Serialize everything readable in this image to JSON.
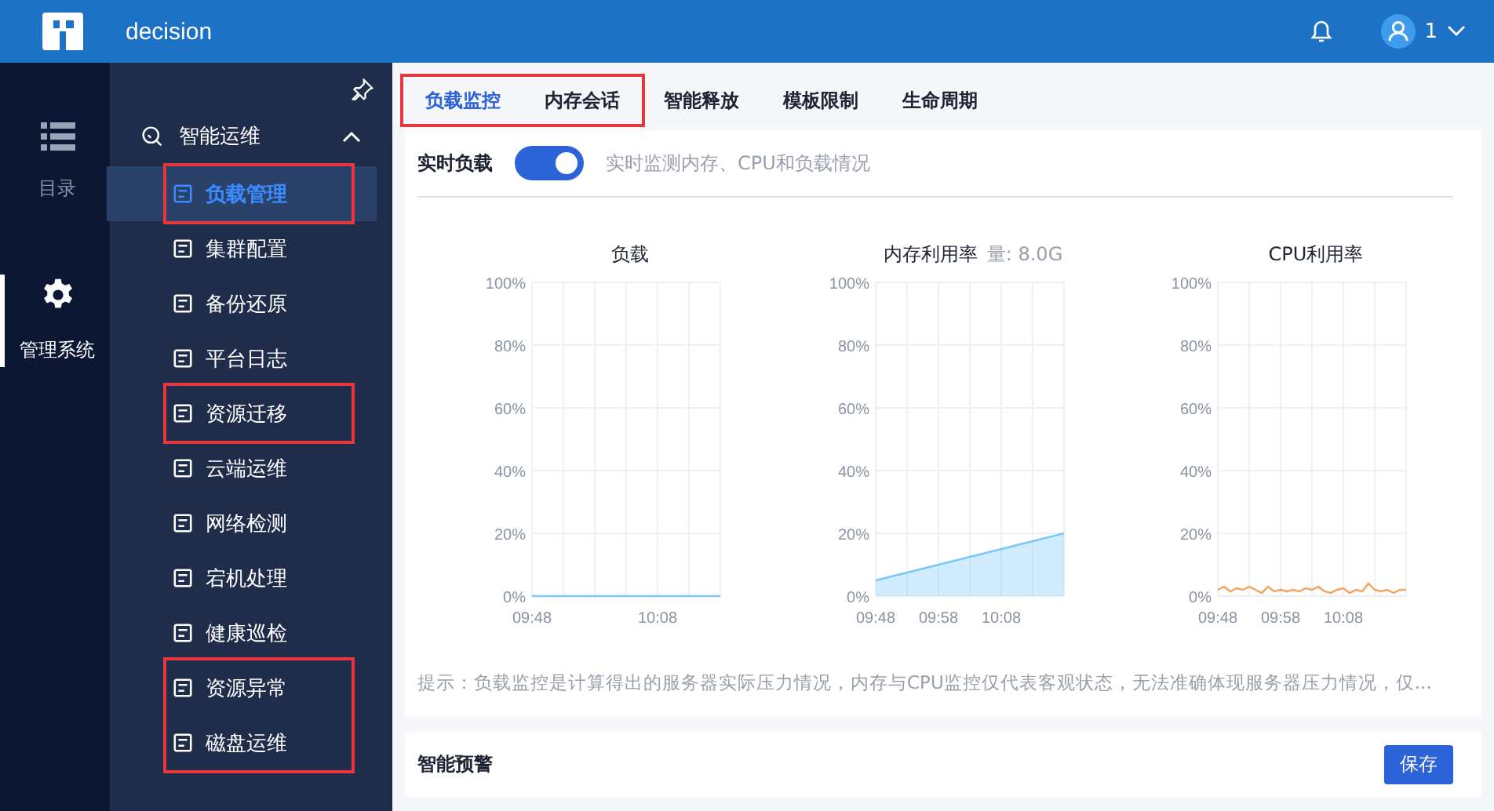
{
  "header": {
    "title": "decision",
    "user": "1"
  },
  "rail": [
    {
      "label": "目录",
      "selected": false
    },
    {
      "label": "管理系统",
      "selected": true
    }
  ],
  "sidebar": {
    "group": {
      "label": "智能运维",
      "expanded": true
    },
    "sections": [
      {
        "annotated": true,
        "items": [
          {
            "label": "负载管理",
            "selected": true
          }
        ]
      },
      {
        "annotated": false,
        "items": [
          {
            "label": "集群配置",
            "selected": false
          },
          {
            "label": "备份还原",
            "selected": false
          },
          {
            "label": "平台日志",
            "selected": false
          }
        ]
      },
      {
        "annotated": true,
        "items": [
          {
            "label": "资源迁移",
            "selected": false
          }
        ]
      },
      {
        "annotated": false,
        "items": [
          {
            "label": "云端运维",
            "selected": false
          },
          {
            "label": "网络检测",
            "selected": false
          },
          {
            "label": "宕机处理",
            "selected": false
          },
          {
            "label": "健康巡检",
            "selected": false
          }
        ]
      },
      {
        "annotated": true,
        "items": [
          {
            "label": "资源异常",
            "selected": false
          },
          {
            "label": "磁盘运维",
            "selected": false
          }
        ]
      }
    ]
  },
  "tab_groups": [
    {
      "annotated": true,
      "tabs": [
        {
          "label": "负载监控",
          "selected": true
        },
        {
          "label": "内存会话",
          "selected": false
        }
      ]
    },
    {
      "annotated": false,
      "tabs": [
        {
          "label": "智能释放",
          "selected": false
        },
        {
          "label": "模板限制",
          "selected": false
        },
        {
          "label": "生命周期",
          "selected": false
        }
      ]
    }
  ],
  "realtime": {
    "label": "实时负载",
    "on": true,
    "hint": "实时监测内存、CPU和负载情况"
  },
  "charts": [
    {
      "chart_data": {
        "type": "line",
        "title": "负载",
        "grid": true,
        "categories": [
          "09:48",
          null,
          null,
          null,
          null,
          null,
          null,
          null,
          null,
          null,
          null,
          null,
          null,
          null,
          null,
          null,
          null,
          null,
          null,
          null,
          "10:08",
          null,
          null,
          null,
          null,
          null,
          null,
          null,
          null,
          null,
          null
        ],
        "ylim": [
          0,
          100
        ],
        "yticks": [
          {
            "value": 0,
            "label": "0%"
          },
          {
            "value": 20,
            "label": "20%"
          },
          {
            "value": 40,
            "label": "40%"
          },
          {
            "value": 60,
            "label": "60%"
          },
          {
            "value": 80,
            "label": "80%"
          },
          {
            "value": 100,
            "label": "100%"
          }
        ],
        "series": [
          {
            "color": "#7cc8f5",
            "values": [
              0,
              0,
              0,
              0,
              0,
              0,
              0,
              0,
              0,
              0,
              0,
              0,
              0,
              0,
              0,
              0,
              0,
              0,
              0,
              0,
              0,
              0,
              0,
              0,
              0,
              0,
              0,
              0,
              0,
              0,
              0
            ]
          }
        ]
      }
    },
    {
      "note": "量: 8.0G",
      "chart_data": {
        "type": "area",
        "title": "内存利用率",
        "grid": true,
        "categories": [
          "09:48",
          null,
          null,
          null,
          null,
          null,
          null,
          null,
          null,
          null,
          "09:58",
          null,
          null,
          null,
          null,
          null,
          null,
          null,
          null,
          null,
          "10:08",
          null,
          null,
          null,
          null,
          null,
          null,
          null,
          null,
          null,
          null
        ],
        "ylim": [
          0,
          100
        ],
        "yticks": [
          {
            "value": 0,
            "label": "0%"
          },
          {
            "value": 20,
            "label": "20%"
          },
          {
            "value": 40,
            "label": "40%"
          },
          {
            "value": 60,
            "label": "60%"
          },
          {
            "value": 80,
            "label": "80%"
          },
          {
            "value": 100,
            "label": "100%"
          }
        ],
        "series": [
          {
            "color": "#7cc8f5",
            "values": [
              5,
              5.5,
              6,
              6.5,
              7,
              7.5,
              8,
              8.5,
              9,
              9.5,
              10,
              10.5,
              11,
              11.5,
              12,
              12.5,
              13,
              13.5,
              14,
              14.5,
              15,
              15.5,
              16,
              16.5,
              17,
              17.5,
              18,
              18.5,
              19,
              19.5,
              20
            ]
          }
        ]
      }
    },
    {
      "chart_data": {
        "type": "line",
        "title": "CPU利用率",
        "grid": true,
        "categories": [
          "09:48",
          null,
          null,
          null,
          null,
          null,
          null,
          null,
          null,
          null,
          "09:58",
          null,
          null,
          null,
          null,
          null,
          null,
          null,
          null,
          null,
          "10:08",
          null,
          null,
          null,
          null,
          null,
          null,
          null,
          null,
          null,
          null
        ],
        "ylim": [
          0,
          100
        ],
        "yticks": [
          {
            "value": 0,
            "label": "0%"
          },
          {
            "value": 20,
            "label": "20%"
          },
          {
            "value": 40,
            "label": "40%"
          },
          {
            "value": 60,
            "label": "60%"
          },
          {
            "value": 80,
            "label": "80%"
          },
          {
            "value": 100,
            "label": "100%"
          }
        ],
        "series": [
          {
            "color": "#f5a25d",
            "values": [
              2,
              3,
              1.5,
              2.5,
              2,
              3,
              2,
              1,
              3,
              1.5,
              2,
              1.5,
              2,
              1.5,
              2.5,
              2,
              3,
              1.5,
              1,
              2,
              2.5,
              1,
              2,
              1.5,
              4,
              2,
              1.5,
              2,
              1,
              2,
              2
            ]
          }
        ]
      }
    }
  ],
  "tip": "提示：负载监控是计算得出的服务器实际压力情况，内存与CPU监控仅代表客观状态，无法准确体现服务器压力情况，仅...",
  "warning_section": {
    "title": "智能预警",
    "save": "保存"
  }
}
